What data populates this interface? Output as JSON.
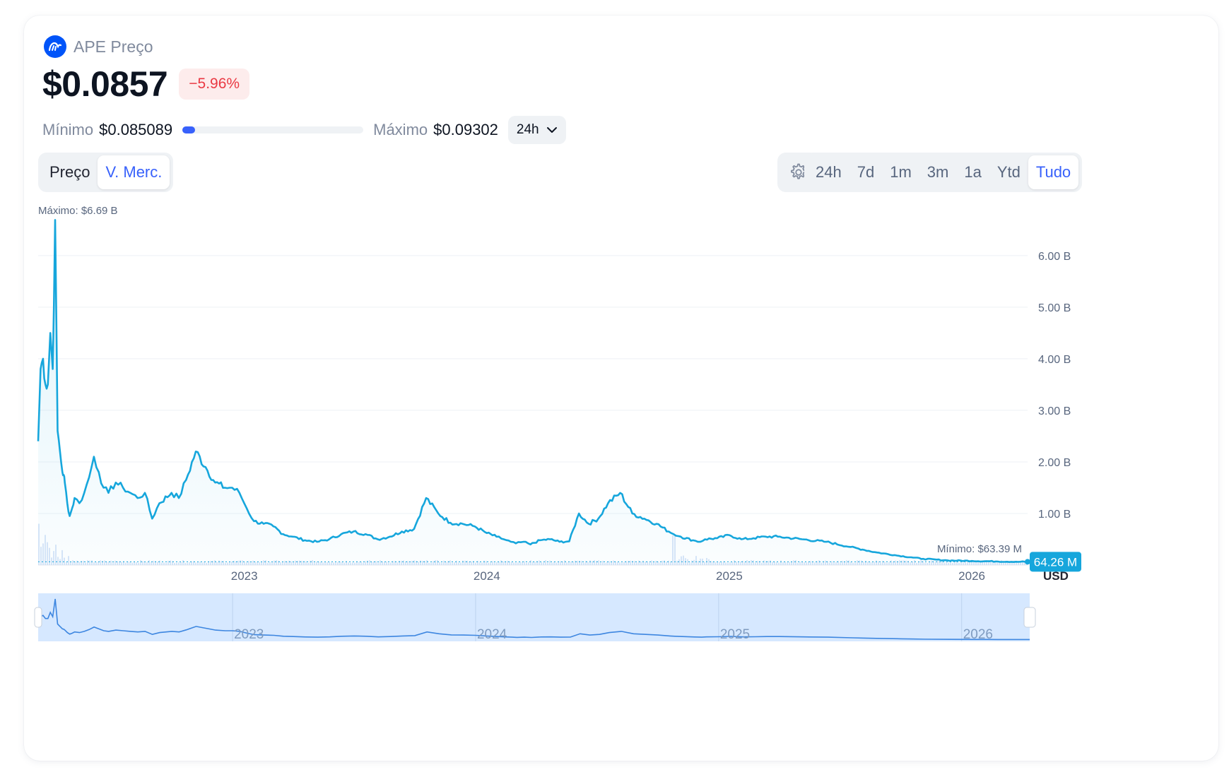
{
  "header": {
    "title": "APE Preço",
    "price": "$0.0857",
    "change": "−5.96%"
  },
  "range": {
    "min_label": "Mínimo",
    "min_value": "$0.085089",
    "max_label": "Máximo",
    "max_value": "$0.09302",
    "position_fraction": 0.07,
    "period": "24h"
  },
  "tabs": {
    "left": [
      {
        "label": "Preço",
        "active": false
      },
      {
        "label": "V. Merc.",
        "active": true
      }
    ],
    "right": [
      {
        "label": "24h",
        "active": false
      },
      {
        "label": "7d",
        "active": false
      },
      {
        "label": "1m",
        "active": false
      },
      {
        "label": "3m",
        "active": false
      },
      {
        "label": "1a",
        "active": false
      },
      {
        "label": "Ytd",
        "active": false
      },
      {
        "label": "Tudo",
        "active": true
      }
    ]
  },
  "icons": {
    "logo": "ape-coin-logo",
    "settings": "gear-icon",
    "dropdown": "chevron-down-icon"
  },
  "colors": {
    "line": "#16a6dc",
    "accent": "#3861fb",
    "negative": "#ea3943",
    "navigator_fill": "#d6e8ff"
  },
  "chart_data": {
    "type": "area",
    "max_annotation": "Máximo: $6.69 B",
    "min_annotation": "Mínimo: $63.39 M",
    "current_label": "64.26 M",
    "currency": "USD",
    "y_tick_labels": [
      "6.00 B",
      "5.00 B",
      "4.00 B",
      "3.00 B",
      "2.00 B",
      "1.00 B"
    ],
    "y_ticks": [
      6.0,
      5.0,
      4.0,
      3.0,
      2.0,
      1.0
    ],
    "ylim": [
      0,
      6.6
    ],
    "x_tick_labels": [
      "2023",
      "2024",
      "2025",
      "2026"
    ],
    "x_ticks": [
      2023.0,
      2024.0,
      2025.0,
      2026.0
    ],
    "xlim": [
      2022.15,
      2026.23
    ],
    "series": [
      {
        "unit": "USD billions",
        "x": [
          2022.15,
          2022.16,
          2022.17,
          2022.18,
          2022.19,
          2022.2,
          2022.21,
          2022.22,
          2022.23,
          2022.24,
          2022.25,
          2022.255,
          2022.26,
          2022.27,
          2022.28,
          2022.29,
          2022.3,
          2022.32,
          2022.34,
          2022.36,
          2022.38,
          2022.4,
          2022.42,
          2022.44,
          2022.47,
          2022.5,
          2022.53,
          2022.56,
          2022.59,
          2022.62,
          2022.65,
          2022.7,
          2022.73,
          2022.76,
          2022.8,
          2022.84,
          2022.88,
          2022.92,
          2022.95,
          2022.98,
          2023.01,
          2023.04,
          2023.08,
          2023.12,
          2023.16,
          2023.2,
          2023.25,
          2023.3,
          2023.35,
          2023.4,
          2023.45,
          2023.5,
          2023.55,
          2023.6,
          2023.65,
          2023.7,
          2023.75,
          2023.8,
          2023.85,
          2023.9,
          2023.95,
          2024.0,
          2024.04,
          2024.07,
          2024.1,
          2024.12,
          2024.15,
          2024.18,
          2024.22,
          2024.26,
          2024.3,
          2024.34,
          2024.38,
          2024.42,
          2024.46,
          2024.5,
          2024.55,
          2024.6,
          2024.65,
          2024.7,
          2024.75,
          2024.77,
          2024.8,
          2024.85,
          2024.88,
          2024.9,
          2024.95,
          2025.0,
          2025.05,
          2025.1,
          2025.15,
          2025.2,
          2025.3,
          2025.4,
          2025.5,
          2025.55,
          2025.6,
          2025.7,
          2025.75,
          2025.8,
          2025.9,
          2026.0,
          2026.1,
          2026.2,
          2026.23
        ],
        "y": [
          2.4,
          3.8,
          4.0,
          3.5,
          3.5,
          4.5,
          3.8,
          6.69,
          2.6,
          2.2,
          1.8,
          1.75,
          1.6,
          1.2,
          0.95,
          1.1,
          1.3,
          1.2,
          1.4,
          1.7,
          2.1,
          1.8,
          1.5,
          1.4,
          1.6,
          1.5,
          1.4,
          1.3,
          1.4,
          0.9,
          1.2,
          1.4,
          1.3,
          1.65,
          2.2,
          1.9,
          1.6,
          1.5,
          1.5,
          1.4,
          1.1,
          0.85,
          0.8,
          0.75,
          0.6,
          0.55,
          0.48,
          0.45,
          0.5,
          0.6,
          0.65,
          0.6,
          0.5,
          0.55,
          0.65,
          0.7,
          1.3,
          1.0,
          0.82,
          0.8,
          0.75,
          0.62,
          0.55,
          0.5,
          0.45,
          0.42,
          0.45,
          0.4,
          0.48,
          0.5,
          0.45,
          0.46,
          1.0,
          0.8,
          0.9,
          1.2,
          1.4,
          1.0,
          0.9,
          0.8,
          0.65,
          0.6,
          0.55,
          0.48,
          0.45,
          0.5,
          0.52,
          0.58,
          0.5,
          0.52,
          0.55,
          0.55,
          0.5,
          0.45,
          0.35,
          0.3,
          0.25,
          0.18,
          0.15,
          0.12,
          0.09,
          0.08,
          0.07,
          0.065,
          0.064
        ]
      }
    ],
    "grid": true,
    "y_axis_position": "right"
  }
}
